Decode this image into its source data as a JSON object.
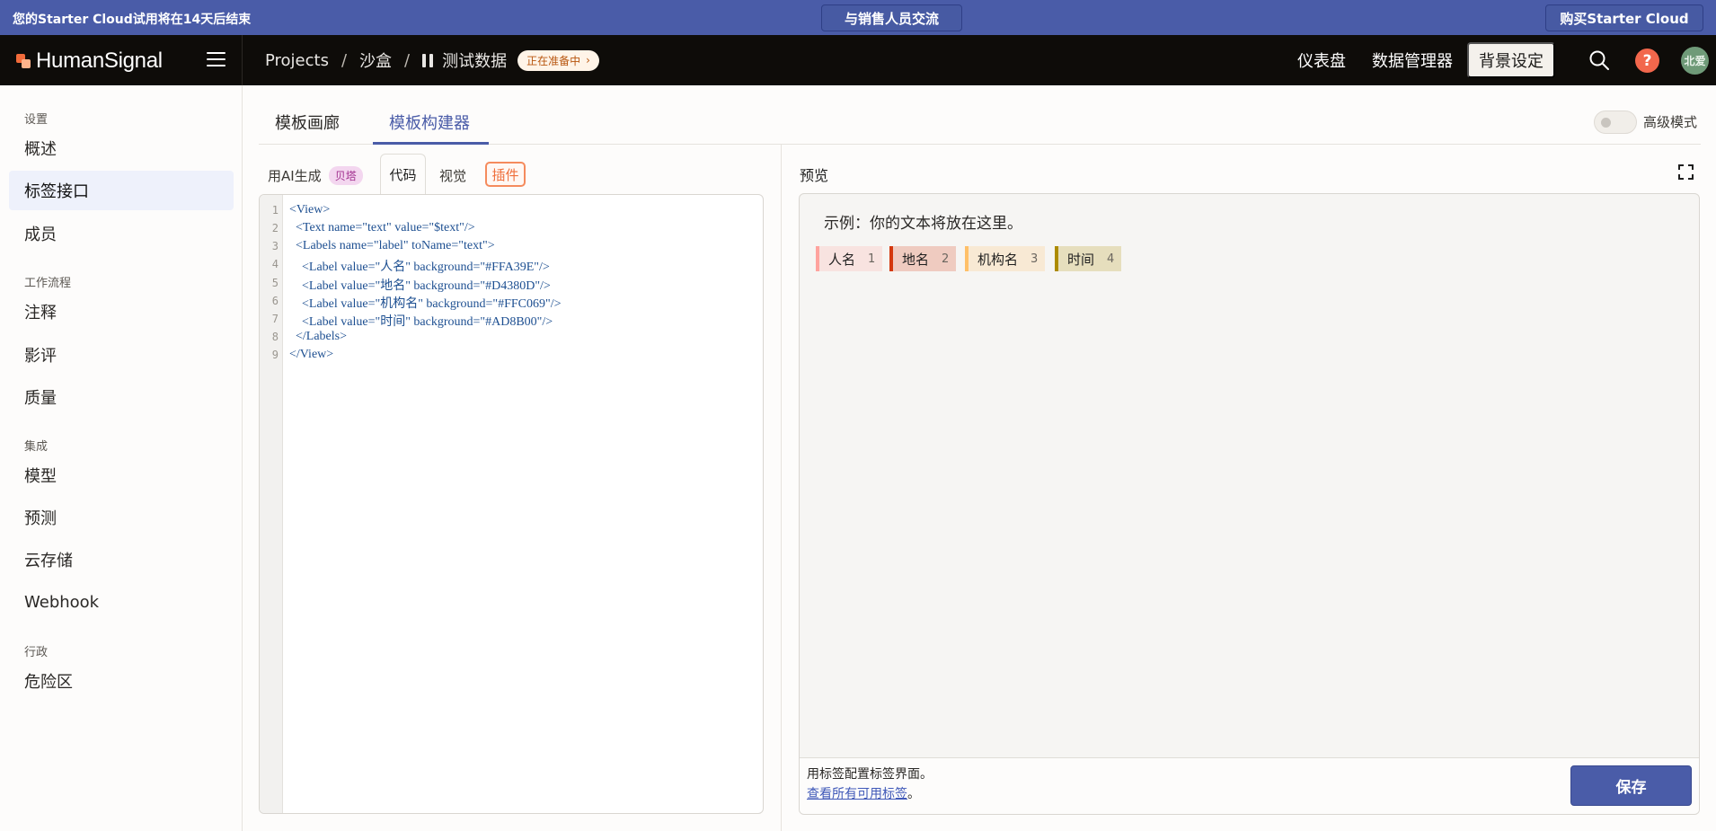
{
  "banner": {
    "trial_text": "您的Starter Cloud试用将在14天后结束",
    "sales_button": "与销售人员交流",
    "buy_button": "购买Starter Cloud",
    "color": "#4a5ca8"
  },
  "header": {
    "logo_text": "HumanSignal",
    "breadcrumb": {
      "projects": "Projects",
      "sep": "/",
      "workspace": "沙盒",
      "project": "测试数据",
      "status": "正在准备中",
      "status_chevron": "›"
    },
    "nav_dashboard": "仪表盘",
    "nav_data_manager": "数据管理器",
    "settings_button": "背景设定",
    "help_glyph": "?",
    "avatar_initials": "北爱"
  },
  "sidebar": {
    "groups": {
      "settings": "设置",
      "workflow": "工作流程",
      "integrations": "集成",
      "admin": "行政"
    },
    "items": [
      {
        "label": "概述",
        "active": false
      },
      {
        "label": "标签接口",
        "active": true
      },
      {
        "label": "成员",
        "active": false
      },
      {
        "label": "注释",
        "active": false
      },
      {
        "label": "影评",
        "active": false
      },
      {
        "label": "质量",
        "active": false
      },
      {
        "label": "模型",
        "active": false
      },
      {
        "label": "预测",
        "active": false
      },
      {
        "label": "云存储",
        "active": false
      },
      {
        "label": "Webhook",
        "active": false
      },
      {
        "label": "危险区",
        "active": false
      }
    ]
  },
  "tabs": {
    "gallery": "模板画廊",
    "builder": "模板构建器",
    "advanced_mode": "高级模式"
  },
  "editor_tabs": {
    "ai_generate": "用AI生成",
    "beta": "贝塔",
    "code": "代码",
    "visual": "视觉",
    "plugins": "插件"
  },
  "code_lines": [
    "<View>",
    "  <Text name=\"text\" value=\"$text\"/>",
    "  <Labels name=\"label\" toName=\"text\">",
    "    <Label value=\"人名\" background=\"#FFA39E\"/>",
    "    <Label value=\"地名\" background=\"#D4380D\"/>",
    "    <Label value=\"机构名\" background=\"#FFC069\"/>",
    "    <Label value=\"时间\" background=\"#AD8B00\"/>",
    "  </Labels>",
    "</View>"
  ],
  "preview": {
    "title": "预览",
    "sample_text": "示例：你的文本将放在这里。",
    "labels": [
      {
        "name": "人名",
        "hotkey": "1",
        "color": "#FFA39E"
      },
      {
        "name": "地名",
        "hotkey": "2",
        "color": "#D4380D"
      },
      {
        "name": "机构名",
        "hotkey": "3",
        "color": "#FFC069"
      },
      {
        "name": "时间",
        "hotkey": "4",
        "color": "#AD8B00"
      }
    ],
    "footer_line1": "用标签配置标签界面。",
    "footer_link": "查看所有可用标签",
    "footer_period": "。",
    "save_button": "保存"
  }
}
